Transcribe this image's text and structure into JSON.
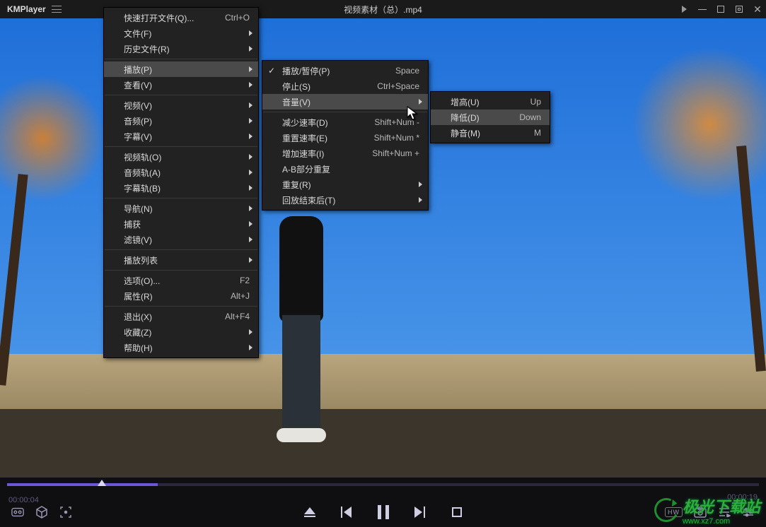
{
  "app_name": "KMPlayer",
  "title": "视频素材（总）.mp4",
  "time_current": "00:00:04",
  "time_total": "00:00:19",
  "hw_badge": "HW",
  "watermark_main": "极光下载站",
  "watermark_sub": "www.xz7.com",
  "menu1": [
    {
      "label": "快速打开文件(Q)...",
      "shortcut": "Ctrl+O"
    },
    {
      "label": "文件(F)",
      "sub": true
    },
    {
      "label": "历史文件(R)",
      "sub": true
    },
    {
      "sep": true
    },
    {
      "label": "播放(P)",
      "sub": true,
      "hl": true
    },
    {
      "label": "查看(V)",
      "sub": true
    },
    {
      "sep": true
    },
    {
      "label": "视频(V)",
      "sub": true
    },
    {
      "label": "音频(P)",
      "sub": true
    },
    {
      "label": "字幕(V)",
      "sub": true
    },
    {
      "sep": true
    },
    {
      "label": "视频轨(O)",
      "sub": true
    },
    {
      "label": "音频轨(A)",
      "sub": true
    },
    {
      "label": "字幕轨(B)",
      "sub": true
    },
    {
      "sep": true
    },
    {
      "label": "导航(N)",
      "sub": true
    },
    {
      "label": "捕获",
      "sub": true
    },
    {
      "label": "滤镜(V)",
      "sub": true
    },
    {
      "sep": true
    },
    {
      "label": "播放列表",
      "sub": true
    },
    {
      "sep": true
    },
    {
      "label": "选项(O)...",
      "shortcut": "F2"
    },
    {
      "label": "属性(R)",
      "shortcut": "Alt+J"
    },
    {
      "sep": true
    },
    {
      "label": "退出(X)",
      "shortcut": "Alt+F4"
    },
    {
      "label": "收藏(Z)",
      "sub": true
    },
    {
      "label": "帮助(H)",
      "sub": true
    }
  ],
  "menu2": [
    {
      "label": "播放/暂停(P)",
      "shortcut": "Space",
      "check": true
    },
    {
      "label": "停止(S)",
      "shortcut": "Ctrl+Space"
    },
    {
      "label": "音量(V)",
      "sub": true,
      "hl": true
    },
    {
      "sep": true
    },
    {
      "label": "减少速率(D)",
      "shortcut": "Shift+Num -"
    },
    {
      "label": "重置速率(E)",
      "shortcut": "Shift+Num *"
    },
    {
      "label": "增加速率(I)",
      "shortcut": "Shift+Num +"
    },
    {
      "label": "A-B部分重复"
    },
    {
      "label": "重复(R)",
      "sub": true
    },
    {
      "label": "回放结束后(T)",
      "sub": true
    }
  ],
  "menu3": [
    {
      "label": "增高(U)",
      "shortcut": "Up"
    },
    {
      "label": "降低(D)",
      "shortcut": "Down",
      "hl": true
    },
    {
      "label": "静音(M)",
      "shortcut": "M"
    }
  ]
}
